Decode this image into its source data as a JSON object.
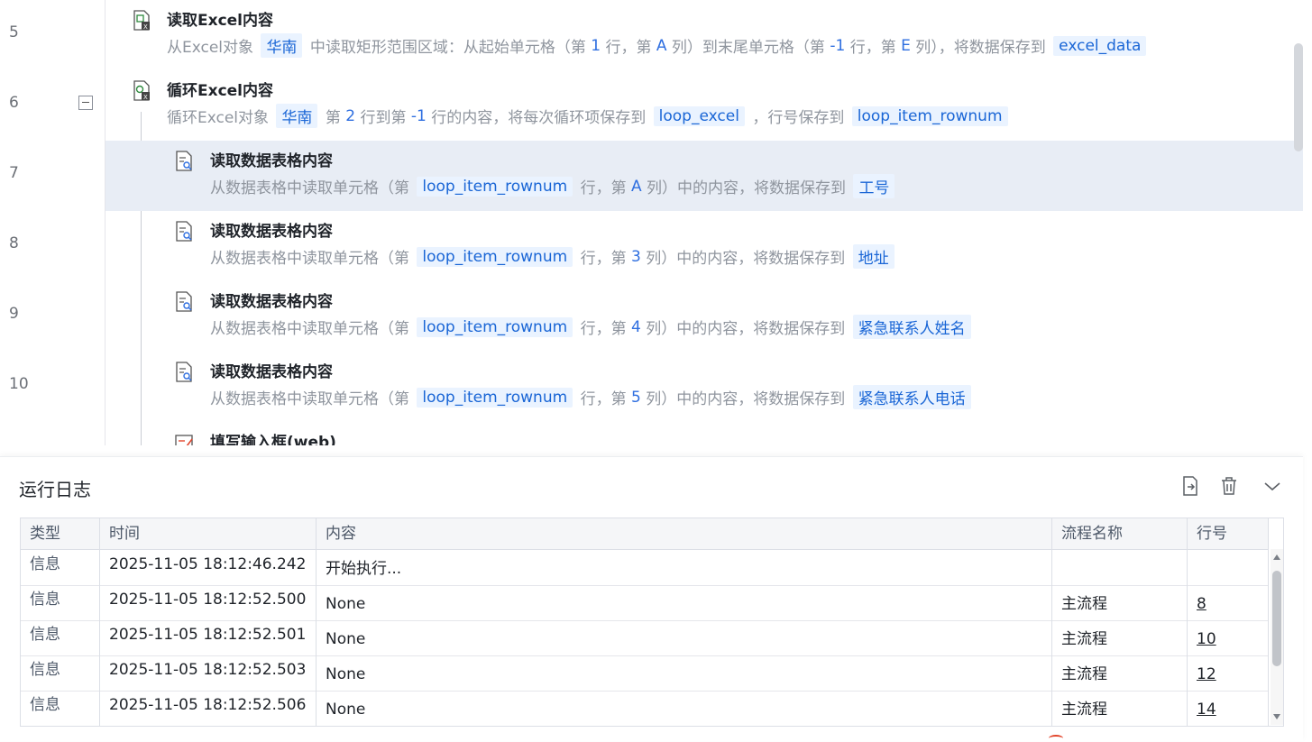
{
  "editor": {
    "line_numbers": [
      "5",
      "6",
      "7",
      "8",
      "9",
      "10"
    ],
    "steps": [
      {
        "title": "读取Excel内容",
        "icon": "excel-read-icon",
        "desc": [
          {
            "t": "从Excel对象 ",
            "k": "text"
          },
          {
            "t": "华南",
            "k": "chip"
          },
          {
            "t": " 中读取矩形范围区域：从起始单元格（第 ",
            "k": "text"
          },
          {
            "t": "1",
            "k": "tok"
          },
          {
            "t": " 行，第 ",
            "k": "text"
          },
          {
            "t": "A",
            "k": "tok"
          },
          {
            "t": " 列）到末尾单元格（第 ",
            "k": "text"
          },
          {
            "t": "-1",
            "k": "tok"
          },
          {
            "t": " 行，第 ",
            "k": "text"
          },
          {
            "t": "E",
            "k": "tok"
          },
          {
            "t": " 列），将数据保存到 ",
            "k": "text"
          },
          {
            "t": "excel_data",
            "k": "chip"
          }
        ]
      },
      {
        "title": "循环Excel内容",
        "icon": "excel-loop-icon",
        "desc": [
          {
            "t": "循环Excel对象 ",
            "k": "text"
          },
          {
            "t": "华南",
            "k": "chip"
          },
          {
            "t": " 第 ",
            "k": "text"
          },
          {
            "t": "2",
            "k": "tok"
          },
          {
            "t": " 行到第 ",
            "k": "text"
          },
          {
            "t": "-1",
            "k": "tok"
          },
          {
            "t": " 行的内容，将每次循环项保存到 ",
            "k": "text"
          },
          {
            "t": "loop_excel",
            "k": "chip"
          },
          {
            "t": " ，行号保存到 ",
            "k": "text"
          },
          {
            "t": "loop_item_rownum",
            "k": "chip"
          }
        ]
      },
      {
        "title": "读取数据表格内容",
        "icon": "table-read-icon",
        "desc": [
          {
            "t": "从数据表格中读取单元格（第 ",
            "k": "text"
          },
          {
            "t": "loop_item_rownum",
            "k": "chip"
          },
          {
            "t": " 行，第 ",
            "k": "text"
          },
          {
            "t": "A",
            "k": "tok"
          },
          {
            "t": " 列）中的内容，将数据保存到 ",
            "k": "text"
          },
          {
            "t": "工号",
            "k": "chip"
          }
        ]
      },
      {
        "title": "读取数据表格内容",
        "icon": "table-read-icon",
        "desc": [
          {
            "t": "从数据表格中读取单元格（第 ",
            "k": "text"
          },
          {
            "t": "loop_item_rownum",
            "k": "chip"
          },
          {
            "t": " 行，第 ",
            "k": "text"
          },
          {
            "t": "3",
            "k": "tok"
          },
          {
            "t": " 列）中的内容，将数据保存到 ",
            "k": "text"
          },
          {
            "t": "地址",
            "k": "chip"
          }
        ]
      },
      {
        "title": "读取数据表格内容",
        "icon": "table-read-icon",
        "desc": [
          {
            "t": "从数据表格中读取单元格（第 ",
            "k": "text"
          },
          {
            "t": "loop_item_rownum",
            "k": "chip"
          },
          {
            "t": " 行，第 ",
            "k": "text"
          },
          {
            "t": "4",
            "k": "tok"
          },
          {
            "t": " 列）中的内容，将数据保存到 ",
            "k": "text"
          },
          {
            "t": "紧急联系人姓名",
            "k": "chip"
          }
        ]
      },
      {
        "title": "读取数据表格内容",
        "icon": "table-read-icon",
        "desc": [
          {
            "t": "从数据表格中读取单元格（第 ",
            "k": "text"
          },
          {
            "t": "loop_item_rownum",
            "k": "chip"
          },
          {
            "t": " 行，第 ",
            "k": "text"
          },
          {
            "t": "5",
            "k": "tok"
          },
          {
            "t": " 列）中的内容，将数据保存到 ",
            "k": "text"
          },
          {
            "t": "紧急联系人电话",
            "k": "chip"
          }
        ]
      },
      {
        "title": "填写输入框(web)",
        "icon": "web-input-icon",
        "desc": []
      }
    ]
  },
  "log": {
    "title": "运行日志",
    "columns": [
      "类型",
      "时间",
      "内容",
      "流程名称",
      "行号"
    ],
    "rows": [
      [
        "信息",
        "2025-11-05 18:12:46.242",
        "开始执行...",
        "",
        ""
      ],
      [
        "信息",
        "2025-11-05 18:12:52.500",
        "None",
        "主流程",
        "8"
      ],
      [
        "信息",
        "2025-11-05 18:12:52.501",
        "None",
        "主流程",
        "10"
      ],
      [
        "信息",
        "2025-11-05 18:12:52.503",
        "None",
        "主流程",
        "12"
      ],
      [
        "信息",
        "2025-11-05 18:12:52.506",
        "None",
        "主流程",
        "14"
      ]
    ],
    "toolbar_icons": [
      "export-log-icon",
      "clear-log-icon",
      "collapse-panel-icon"
    ]
  },
  "colors": {
    "accent": "#1a66d6",
    "chip_bg": "#eaf3ff",
    "selected_row": "#e8edf5"
  }
}
